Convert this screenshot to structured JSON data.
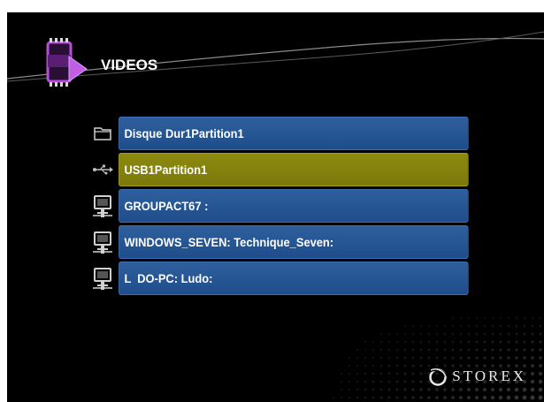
{
  "header": {
    "title": "VIDEOS",
    "icon": "video-film-play-icon"
  },
  "sources": [
    {
      "label": "Disque Dur1Partition1",
      "icon": "folder-icon",
      "selected": false
    },
    {
      "label": "USB1Partition1",
      "icon": "usb-icon",
      "selected": true
    },
    {
      "label": "GROUPACT67 :",
      "icon": "network-computer-icon",
      "selected": false
    },
    {
      "label": "WINDOWS_SEVEN: Technique_Seven:",
      "icon": "network-computer-icon",
      "selected": false
    },
    {
      "label": "L  DO-PC: Ludo:",
      "icon": "network-computer-icon",
      "selected": false
    }
  ],
  "brand": {
    "name": "STOREX",
    "icon": "storex-logo-icon"
  },
  "colors": {
    "background": "#000000",
    "item": "#2a5a99",
    "item_selected": "#8a870f",
    "accent": "#b64fd8"
  }
}
